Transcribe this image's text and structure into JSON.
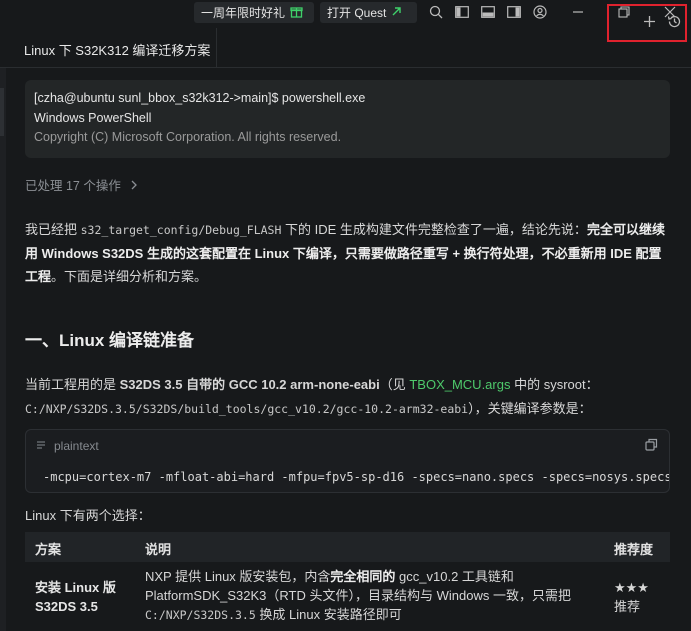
{
  "topbar": {
    "promo1": "一周年限时好礼",
    "promo2": "打开 Quest"
  },
  "tab": {
    "title": "Linux 下 S32K312 编译迁移方案"
  },
  "terminal": {
    "line1": "[czha@ubuntu sunl_bbox_s32k312->main]$ powershell.exe",
    "line2": "Windows PowerShell",
    "line3": "Copyright (C) Microsoft Corporation. All rights reserved."
  },
  "ops": "已处理 17 个操作",
  "intro": {
    "p1": "我已经把 ",
    "code": "s32_target_config/Debug_FLASH",
    "p2": " 下的 IDE 生成构建文件完整检查了一遍，结论先说：",
    "bold1": "完全可以继续",
    "bold2": "用 Windows S32DS 生成的这套配置在 Linux 下编译，只需要做路径重写 + 换行符处理，不必重新用 IDE 配置",
    "bold3": "工程",
    "p3": "。下面是详细分析和方案。"
  },
  "heading": "一、Linux 编译链准备",
  "toolchain": {
    "p1": "当前工程用的是 ",
    "bold": "S32DS 3.5 自带的 GCC 10.2 arm-none-eabi",
    "p2": "（见 ",
    "link": "TBOX_MCU.args",
    "p3": " 中的 sysroot：",
    "path": "C:/NXP/S32DS.3.5/S32DS/build_tools/gcc_v10.2/gcc-10.2-arm32-eabi",
    "p4": "），关键编译参数是："
  },
  "codeblock": {
    "lang": "plaintext",
    "code": "-mcpu=cortex-m7 -mfloat-abi=hard -mfpu=fpv5-sp-d16 -specs=nano.specs -specs=nosys.specs"
  },
  "choices": "Linux 下有两个选择：",
  "table": {
    "headers": [
      "方案",
      "说明",
      "推荐度"
    ],
    "row1": {
      "name_l1": "安装 Linux 版",
      "name_l2": "S32DS 3.5",
      "d1a": "NXP 提供 Linux 版安装包，内含",
      "d1b": "完全相同的",
      "d1c": " gcc_v10.2 工具链和",
      "d2": "PlatformSDK_S32K3（RTD 头文件），目录结构与 Windows 一致，只需把",
      "d3code": "C:/NXP/S32DS.3.5",
      "d3": " 换成 Linux 安装路径即可",
      "stars": "★★★",
      "rec": "推荐"
    }
  }
}
